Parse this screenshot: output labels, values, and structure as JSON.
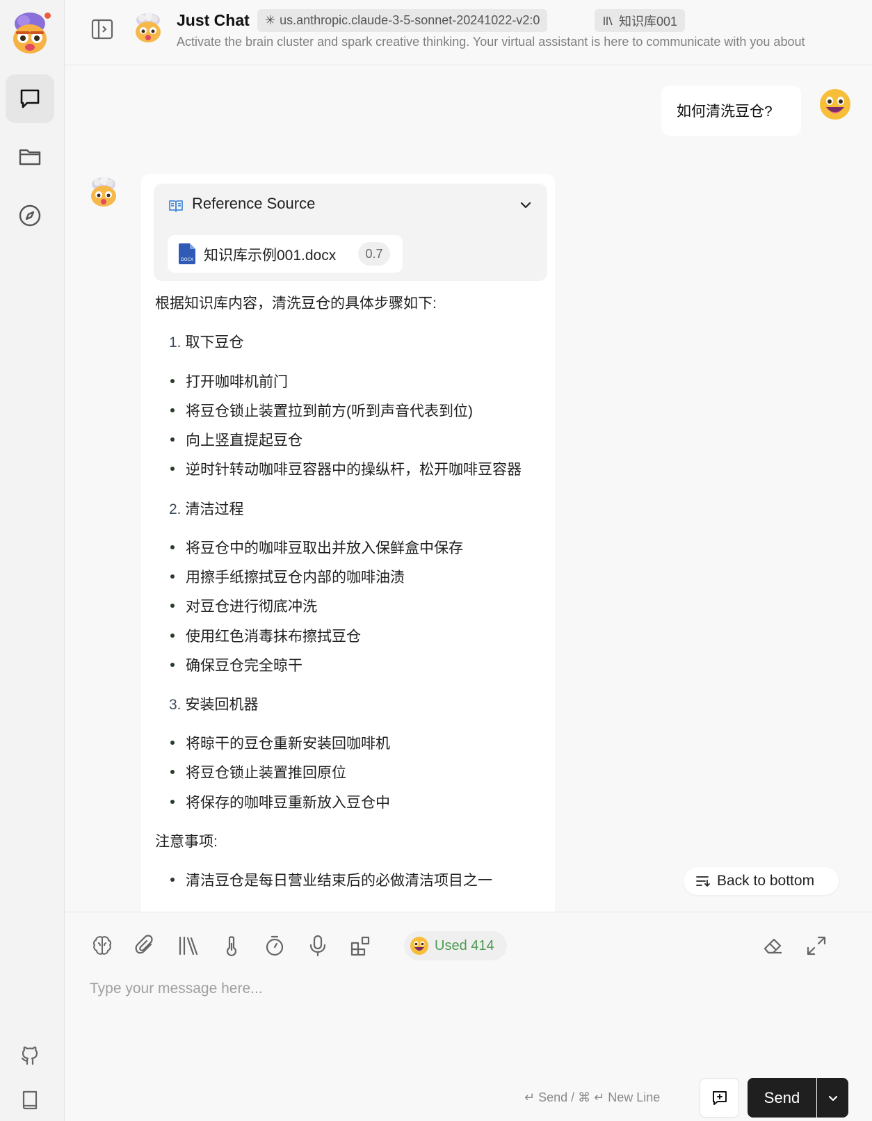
{
  "header": {
    "title": "Just Chat",
    "model_tag": "us.anthropic.claude-3-5-sonnet-20241022-v2:0",
    "kb_tag": "知识库001",
    "description": "Activate the brain cluster and spark creative thinking. Your virtual assistant is here to communicate with you about"
  },
  "sidebar": {
    "items": [
      {
        "name": "chat",
        "icon": "chat-bubble-icon",
        "active": true
      },
      {
        "name": "files",
        "icon": "folder-icon",
        "active": false
      },
      {
        "name": "discover",
        "icon": "compass-icon",
        "active": false
      }
    ],
    "bottom_items": [
      {
        "name": "github",
        "icon": "github-icon"
      },
      {
        "name": "docs",
        "icon": "book-icon"
      }
    ]
  },
  "conversation": {
    "user_message": "如何清洗豆仓?",
    "reference": {
      "title": "Reference Source",
      "file_name": "知识库示例001.docx",
      "score": "0.7"
    },
    "answer": {
      "intro": "根据知识库内容，清洗豆仓的具体步骤如下:",
      "sections": [
        {
          "number": "1.",
          "title": "取下豆仓",
          "items": [
            "打开咖啡机前门",
            "将豆仓锁止装置拉到前方(听到声音代表到位)",
            "向上竖直提起豆仓",
            "逆时针转动咖啡豆容器中的操纵杆，松开咖啡豆容器"
          ]
        },
        {
          "number": "2.",
          "title": "清洁过程",
          "items": [
            "将豆仓中的咖啡豆取出并放入保鲜盒中保存",
            "用擦手纸擦拭豆仓内部的咖啡油渍",
            "对豆仓进行彻底冲洗",
            "使用红色消毒抹布擦拭豆仓",
            "确保豆仓完全晾干"
          ]
        },
        {
          "number": "3.",
          "title": "安装回机器",
          "items": [
            "将晾干的豆仓重新安装回咖啡机",
            "将豆仓锁止装置推回原位",
            "将保存的咖啡豆重新放入豆仓中"
          ]
        }
      ],
      "notes_title": "注意事项:",
      "notes": [
        "清洁豆仓是每日营业结束后的必做清洁项目之一"
      ]
    },
    "back_to_bottom": "Back to bottom"
  },
  "composer": {
    "usage_label": "Used 414",
    "placeholder": "Type your message here...",
    "hint": "↵ Send / ⌘ ↵ New Line",
    "send_label": "Send"
  },
  "colors": {
    "accent_green": "#4c9a52",
    "send_bg": "#1f1f1f",
    "notif_dot": "#ef5a3c"
  }
}
